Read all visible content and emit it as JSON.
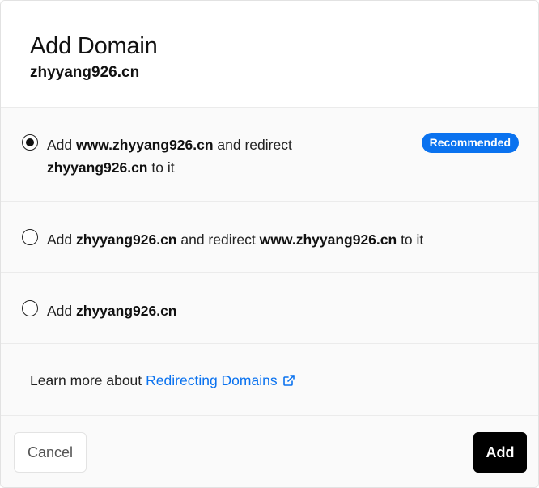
{
  "dialog": {
    "title": "Add Domain",
    "domain": "zhyyang926.cn"
  },
  "options": [
    {
      "selected": true,
      "prefix": "Add ",
      "domain_a": "www.zhyyang926.cn",
      "middle": " and redirect ",
      "domain_b": "zhyyang926.cn",
      "suffix": " to it",
      "badge": "Recommended"
    },
    {
      "selected": false,
      "prefix": "Add ",
      "domain_a": "zhyyang926.cn",
      "middle": " and redirect ",
      "domain_b": "www.zhyyang926.cn",
      "suffix": " to it"
    },
    {
      "selected": false,
      "prefix": "Add ",
      "domain_a": "zhyyang926.cn"
    }
  ],
  "learn_more": {
    "text": "Learn more about",
    "link_label": "Redirecting Domains",
    "icon": "external-link-icon"
  },
  "footer": {
    "cancel_label": "Cancel",
    "add_label": "Add"
  },
  "colors": {
    "accent": "#0a72ef",
    "primary_button": "#000000",
    "panel_background": "#fafafa"
  }
}
